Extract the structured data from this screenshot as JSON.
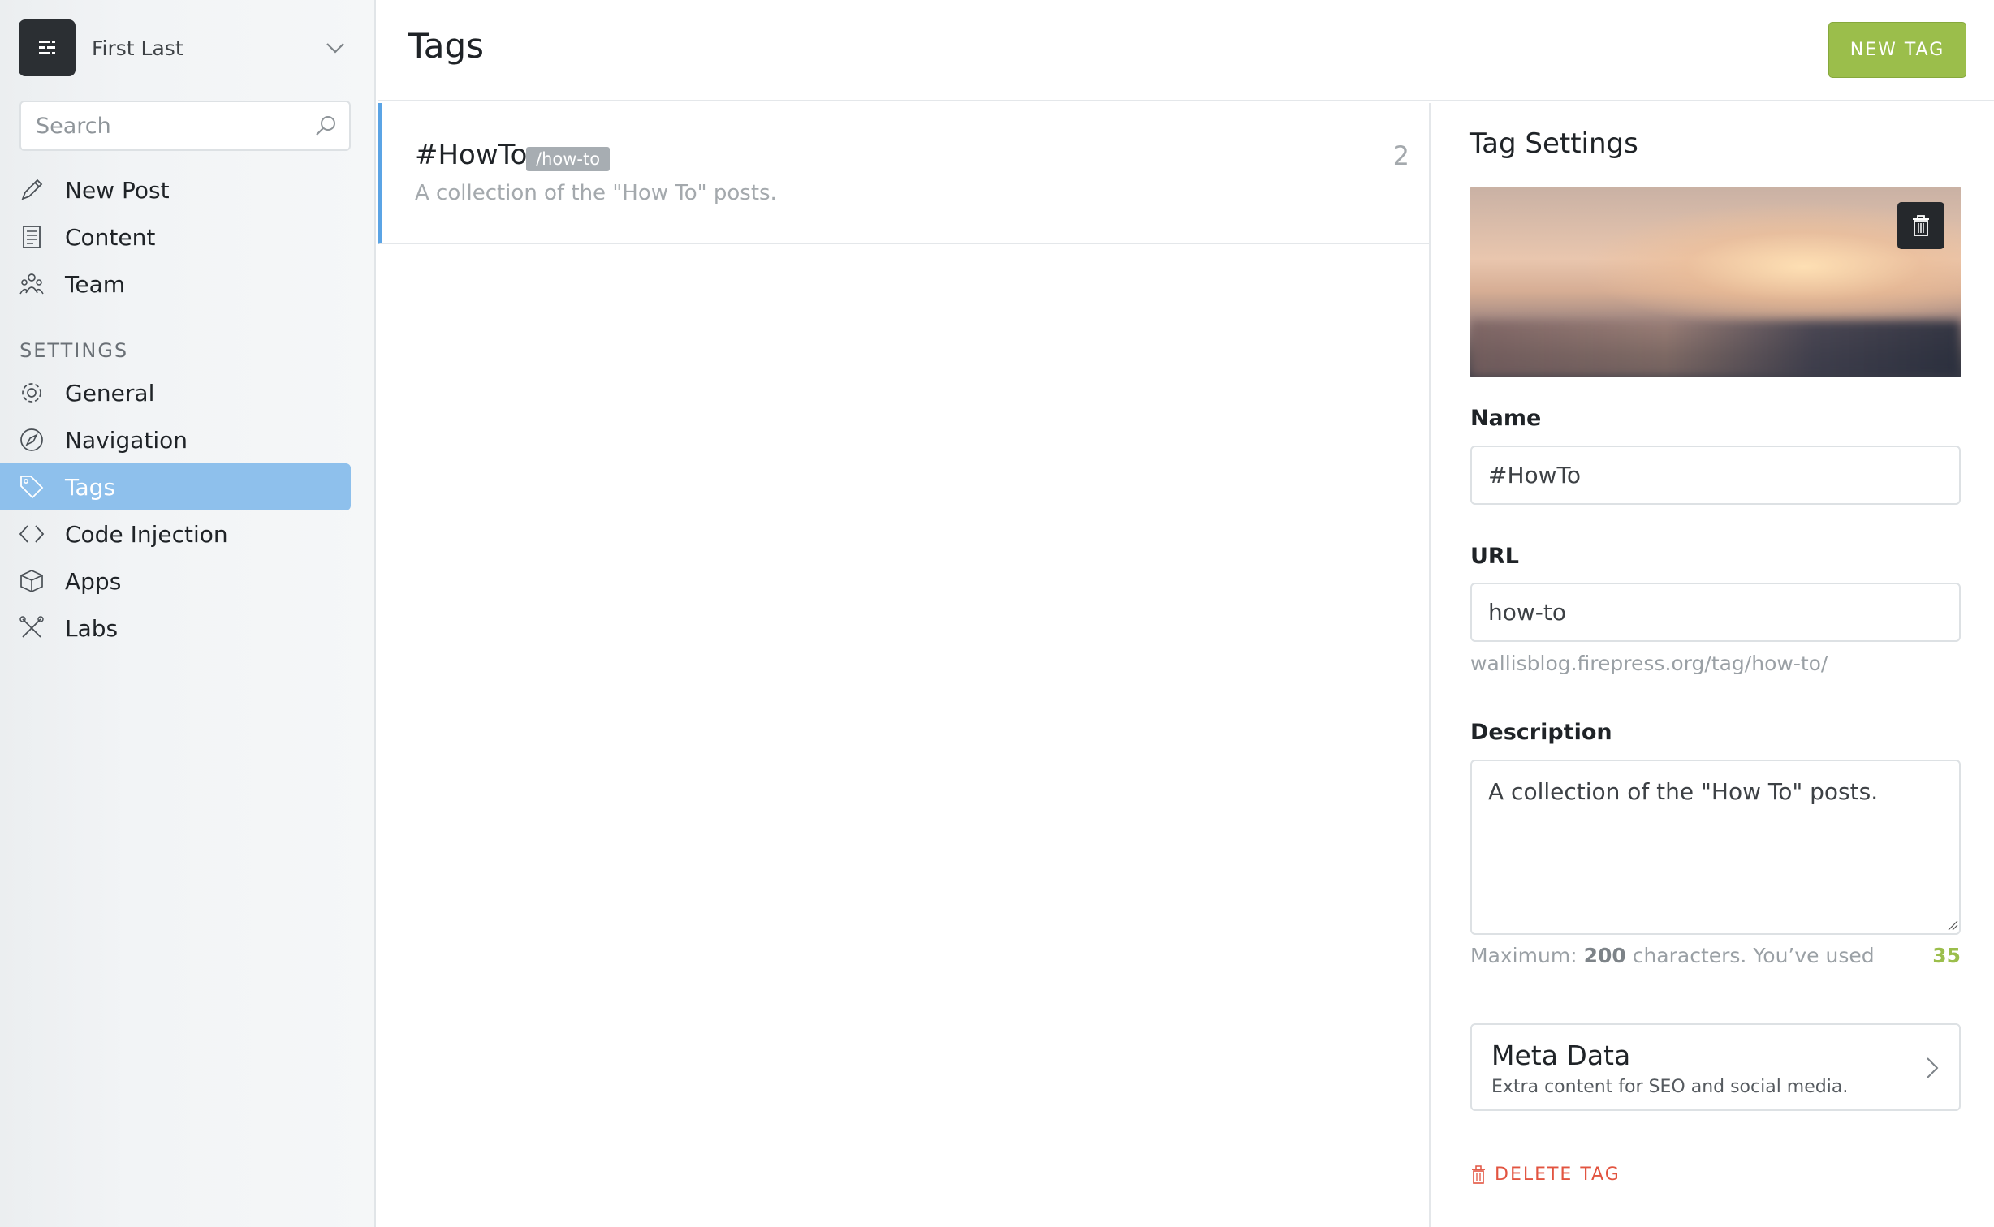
{
  "sidebar": {
    "user_name": "First Last",
    "search_placeholder": "Search",
    "main_items": [
      {
        "label": "New Post",
        "icon": "pencil-icon"
      },
      {
        "label": "Content",
        "icon": "document-icon"
      },
      {
        "label": "Team",
        "icon": "team-icon"
      }
    ],
    "settings_heading": "SETTINGS",
    "settings_items": [
      {
        "label": "General",
        "icon": "gear-icon"
      },
      {
        "label": "Navigation",
        "icon": "compass-icon"
      },
      {
        "label": "Tags",
        "icon": "tag-icon",
        "active": true
      },
      {
        "label": "Code Injection",
        "icon": "code-icon"
      },
      {
        "label": "Apps",
        "icon": "box-icon"
      },
      {
        "label": "Labs",
        "icon": "tools-icon"
      }
    ]
  },
  "header": {
    "title": "Tags",
    "new_tag_label": "NEW TAG"
  },
  "tags": [
    {
      "name": "#HowTo",
      "slug": "/how-to",
      "description": "A collection of the \"How To\" posts.",
      "count": "2"
    }
  ],
  "panel": {
    "title": "Tag Settings",
    "name_label": "Name",
    "name_value": "#HowTo",
    "url_label": "URL",
    "url_value": "how-to",
    "url_preview": "wallisblog.firepress.org/tag/how-to/",
    "description_label": "Description",
    "description_value": "A collection of the \"How To\" posts.",
    "counter_prefix": "Maximum: ",
    "counter_max": "200",
    "counter_suffix": " characters. You’ve used",
    "counter_used": "35",
    "meta_title": "Meta Data",
    "meta_subtitle": "Extra content for SEO and social media.",
    "delete_label": "DELETE TAG"
  },
  "colors": {
    "accent_green": "#9bbe4b",
    "active_nav": "#8ec0ec",
    "selected_border": "#5ba4e5",
    "danger": "#e25440"
  }
}
